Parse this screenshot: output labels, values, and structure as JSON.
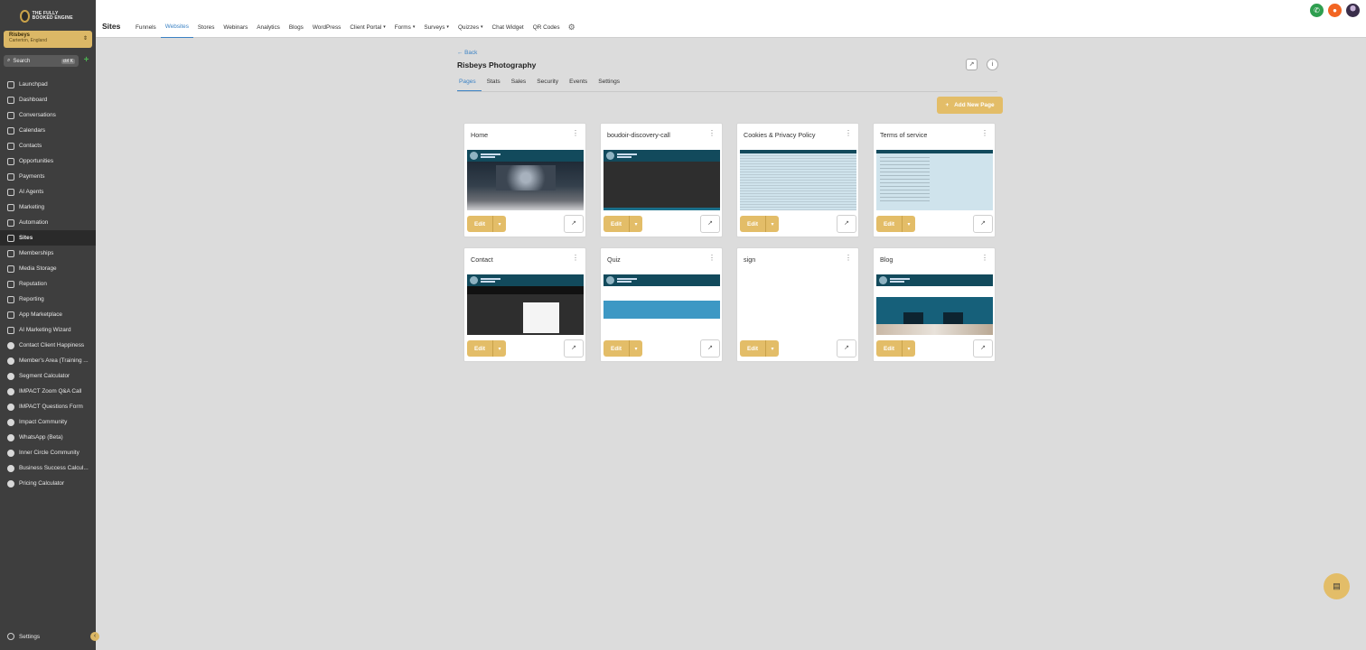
{
  "brand": {
    "logo_text": "THE FULLY BOOKED ENGINE"
  },
  "account": {
    "name": "Risbeys",
    "sub": "Carterton, England"
  },
  "search": {
    "label": "Search",
    "shortcut": "ctrl K"
  },
  "sidebar": {
    "items": [
      {
        "label": "Launchpad",
        "icon": "rocket-icon"
      },
      {
        "label": "Dashboard",
        "icon": "dashboard-icon"
      },
      {
        "label": "Conversations",
        "icon": "chat-icon"
      },
      {
        "label": "Calendars",
        "icon": "calendar-icon"
      },
      {
        "label": "Contacts",
        "icon": "contacts-icon"
      },
      {
        "label": "Opportunities",
        "icon": "opportunities-icon"
      },
      {
        "label": "Payments",
        "icon": "payments-icon"
      },
      {
        "label": "AI Agents",
        "icon": "ai-agents-icon"
      },
      {
        "label": "Marketing",
        "icon": "send-icon"
      },
      {
        "label": "Automation",
        "icon": "automation-icon"
      },
      {
        "label": "Sites",
        "icon": "sites-icon"
      },
      {
        "label": "Memberships",
        "icon": "memberships-icon"
      },
      {
        "label": "Media Storage",
        "icon": "media-icon"
      },
      {
        "label": "Reputation",
        "icon": "star-icon"
      },
      {
        "label": "Reporting",
        "icon": "chart-icon"
      },
      {
        "label": "App Marketplace",
        "icon": "marketplace-icon"
      },
      {
        "label": "AI Marketing Wizard",
        "icon": "wand-icon"
      },
      {
        "label": "Contact Client Happiness",
        "icon": "smile-icon"
      },
      {
        "label": "Member's Area (Training ...",
        "icon": "training-icon"
      },
      {
        "label": "Segment Calculator",
        "icon": "calculator-icon"
      },
      {
        "label": "IMPACT Zoom Q&A Call",
        "icon": "video-icon"
      },
      {
        "label": "IMPACT Questions Form",
        "icon": "question-icon"
      },
      {
        "label": "Impact Community",
        "icon": "community-icon"
      },
      {
        "label": "WhatsApp (Beta)",
        "icon": "whatsapp-icon"
      },
      {
        "label": "Inner Circle Community",
        "icon": "community-icon"
      },
      {
        "label": "Business Success Calcul...",
        "icon": "calculator-icon"
      },
      {
        "label": "Pricing Calculator",
        "icon": "pricing-icon"
      }
    ],
    "active_index": 10,
    "settings_label": "Settings"
  },
  "topbar": {
    "title": "Sites",
    "tabs": [
      {
        "label": "Funnels",
        "dropdown": false
      },
      {
        "label": "Websites",
        "dropdown": false
      },
      {
        "label": "Stores",
        "dropdown": false
      },
      {
        "label": "Webinars",
        "dropdown": false
      },
      {
        "label": "Analytics",
        "dropdown": false
      },
      {
        "label": "Blogs",
        "dropdown": false
      },
      {
        "label": "WordPress",
        "dropdown": false
      },
      {
        "label": "Client Portal",
        "dropdown": true
      },
      {
        "label": "Forms",
        "dropdown": true
      },
      {
        "label": "Surveys",
        "dropdown": true
      },
      {
        "label": "Quizzes",
        "dropdown": true
      },
      {
        "label": "Chat Widget",
        "dropdown": false
      },
      {
        "label": "QR Codes",
        "dropdown": false
      }
    ],
    "active_tab": "Websites"
  },
  "main": {
    "back_label": "← Back",
    "site_title": "Risbeys Photography",
    "subtabs": [
      "Pages",
      "Stats",
      "Sales",
      "Security",
      "Events",
      "Settings"
    ],
    "active_subtab": "Pages",
    "add_button": "Add New Page",
    "edit_label": "Edit",
    "pages": [
      {
        "title": "Home",
        "preview": "home"
      },
      {
        "title": "boudoir-discovery-call",
        "preview": "boudoir"
      },
      {
        "title": "Cookies & Privacy Policy",
        "preview": "document"
      },
      {
        "title": "Terms of service",
        "preview": "document-short"
      },
      {
        "title": "Contact",
        "preview": "contact"
      },
      {
        "title": "Quiz",
        "preview": "quiz"
      },
      {
        "title": "sign",
        "preview": "blank"
      },
      {
        "title": "Blog",
        "preview": "blog"
      }
    ]
  },
  "colors": {
    "accent": "#e3bd68",
    "link": "#3b82c4",
    "sidebar": "#3e3e3e",
    "page_bg": "#dcdcdc"
  }
}
